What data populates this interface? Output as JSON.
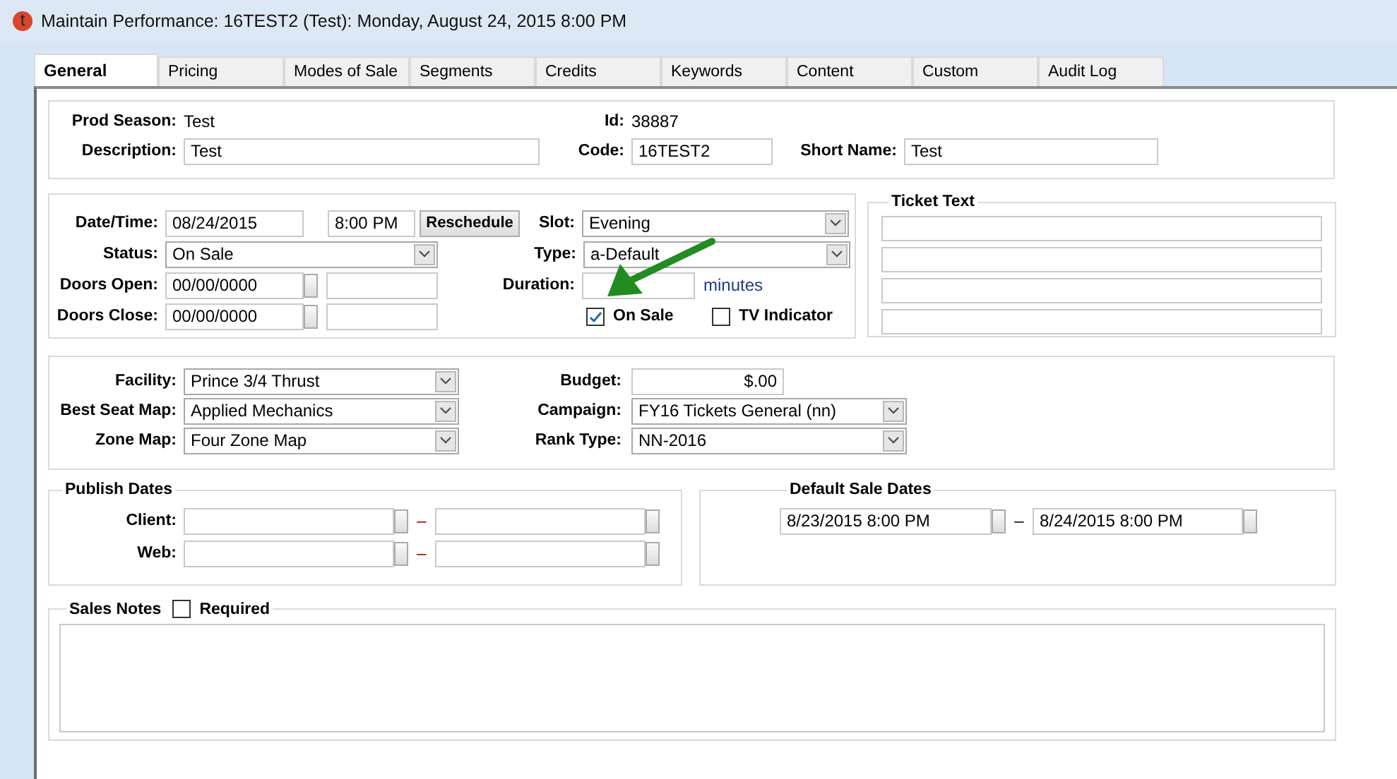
{
  "window": {
    "icon_letter": "t",
    "title": "Maintain Performance: 16TEST2 (Test): Monday, August 24, 2015 8:00 PM"
  },
  "tabs": [
    {
      "label": "General",
      "selected": true
    },
    {
      "label": "Pricing",
      "selected": false
    },
    {
      "label": "Modes of Sale",
      "selected": false
    },
    {
      "label": "Segments",
      "selected": false
    },
    {
      "label": "Credits",
      "selected": false
    },
    {
      "label": "Keywords",
      "selected": false
    },
    {
      "label": "Content",
      "selected": false
    },
    {
      "label": "Custom",
      "selected": false
    },
    {
      "label": "Audit Log",
      "selected": false
    }
  ],
  "basic": {
    "prod_season": {
      "label": "Prod Season:",
      "value": "Test"
    },
    "id": {
      "label": "Id:",
      "value": "38887"
    },
    "description": {
      "label": "Description:",
      "value": "Test"
    },
    "code": {
      "label": "Code:",
      "value": "16TEST2"
    },
    "short_name": {
      "label": "Short Name:",
      "value": "Test"
    }
  },
  "schedule": {
    "date_time": {
      "label": "Date/Time:",
      "date": "08/24/2015",
      "time": "8:00 PM"
    },
    "reschedule_button": "Reschedule",
    "slot": {
      "label": "Slot:",
      "value": "Evening"
    },
    "status": {
      "label": "Status:",
      "value": "On Sale"
    },
    "type": {
      "label": "Type:",
      "value": "a-Default"
    },
    "doors_open": {
      "label": "Doors Open:",
      "date": "00/00/0000"
    },
    "doors_close": {
      "label": "Doors Close:",
      "date": "00/00/0000"
    },
    "duration": {
      "label": "Duration:",
      "unit": "minutes"
    },
    "on_sale": {
      "label": "On Sale",
      "checked": true
    },
    "tv_indicator": {
      "label": "TV Indicator",
      "checked": false
    }
  },
  "ticket_text": {
    "title": "Ticket Text"
  },
  "venue": {
    "facility": {
      "label": "Facility:",
      "value": "Prince 3/4 Thrust"
    },
    "budget": {
      "label": "Budget:",
      "value": "$.00"
    },
    "best_seat_map": {
      "label": "Best Seat Map:",
      "value": "Applied Mechanics"
    },
    "campaign": {
      "label": "Campaign:",
      "value": "FY16 Tickets General (nn)"
    },
    "zone_map": {
      "label": "Zone Map:",
      "value": "Four Zone Map"
    },
    "rank_type": {
      "label": "Rank Type:",
      "value": "NN-2016"
    }
  },
  "publish_dates": {
    "title": "Publish Dates",
    "rows": [
      {
        "label": "Client:",
        "separator": "–"
      },
      {
        "label": "Web:",
        "separator": "–"
      }
    ]
  },
  "default_sale_dates": {
    "title": "Default Sale Dates",
    "start": "8/23/2015 8:00 PM",
    "separator": "–",
    "end": "8/24/2015 8:00 PM"
  },
  "sales_notes": {
    "title": "Sales Notes",
    "required": {
      "label": "Required",
      "checked": false
    }
  }
}
